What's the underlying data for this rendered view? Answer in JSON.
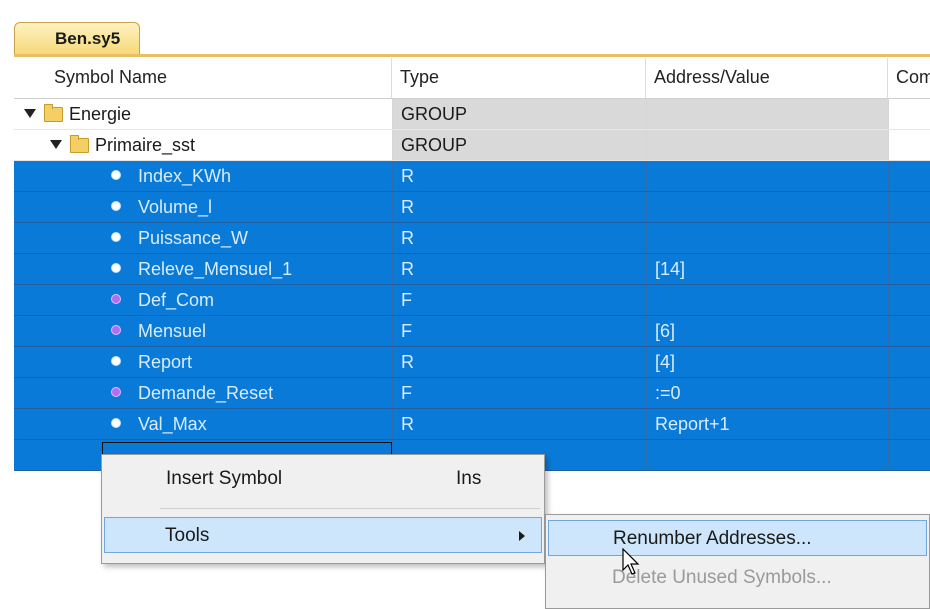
{
  "tab": {
    "label": "Ben.sy5"
  },
  "columns": [
    "Symbol Name",
    "Type",
    "Address/Value",
    "Com"
  ],
  "rows": [
    {
      "name": "Energie",
      "type": "GROUP",
      "addr": "",
      "kind": "group",
      "level": 0,
      "selected": false
    },
    {
      "name": "Primaire_sst",
      "type": "GROUP",
      "addr": "",
      "kind": "group",
      "level": 1,
      "selected": false
    },
    {
      "name": "Index_KWh",
      "type": "R",
      "addr": "",
      "kind": "R",
      "selected": true
    },
    {
      "name": "Volume_l",
      "type": "R",
      "addr": "",
      "kind": "R",
      "selected": true
    },
    {
      "name": "Puissance_W",
      "type": "R",
      "addr": "",
      "kind": "R",
      "selected": true
    },
    {
      "name": "Releve_Mensuel_1",
      "type": "R",
      "addr": "[14]",
      "kind": "R",
      "selected": true
    },
    {
      "name": "Def_Com",
      "type": "F",
      "addr": "",
      "kind": "F",
      "selected": true
    },
    {
      "name": "Mensuel",
      "type": "F",
      "addr": "[6]",
      "kind": "F",
      "selected": true
    },
    {
      "name": "Report",
      "type": "R",
      "addr": "[4]",
      "kind": "R",
      "selected": true
    },
    {
      "name": "Demande_Reset",
      "type": "F",
      "addr": ":=0",
      "kind": "F",
      "selected": true
    },
    {
      "name": "Val_Max",
      "type": "R",
      "addr": "Report+1",
      "kind": "R",
      "selected": true
    },
    {
      "name": "",
      "type": "",
      "addr": "",
      "kind": "edit",
      "selected": true
    }
  ],
  "context_menu": {
    "insert_symbol": "Insert Symbol",
    "insert_shortcut": "Ins",
    "tools": "Tools"
  },
  "submenu": {
    "renumber": "Renumber Addresses...",
    "delete_unused": "Delete Unused Symbols..."
  },
  "colors": {
    "selection": "#0a7ad8",
    "group_cell": "#d9d9d9",
    "tab": "#f6d97a",
    "menu_highlight": "#cde6fb"
  }
}
